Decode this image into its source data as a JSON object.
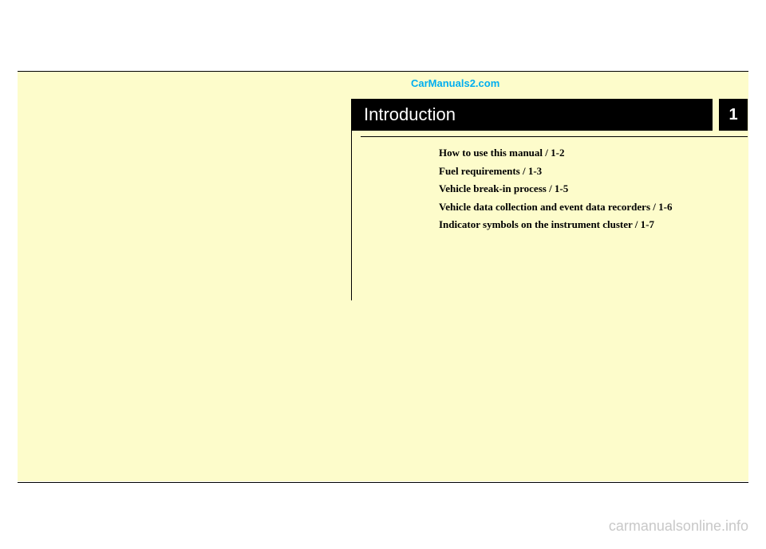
{
  "watermark_top": "CarManuals2.com",
  "chapter": {
    "title": "Introduction",
    "number": "1"
  },
  "toc": {
    "items": [
      "How to use this manual / 1-2",
      "Fuel requirements / 1-3",
      "Vehicle break-in process / 1-5",
      "Vehicle data collection and event data recorders / 1-6",
      "Indicator symbols on the instrument cluster / 1-7"
    ]
  },
  "watermark_bottom": "carmanualsonline.info"
}
